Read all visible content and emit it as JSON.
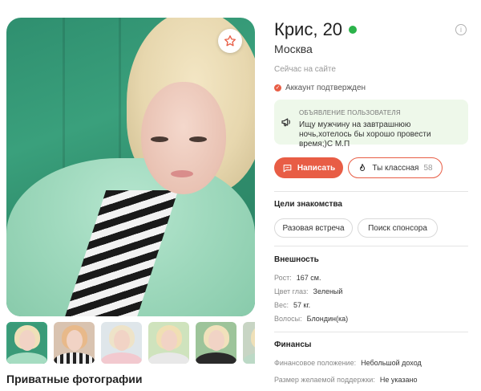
{
  "profile": {
    "name_age": "Крис, 20",
    "city": "Москва",
    "status": "Сейчас на сайте",
    "verified": "Аккаунт подтвержден",
    "online_color": "#2bb34a"
  },
  "announcement": {
    "title": "ОБЪЯВЛЕНИЕ ПОЛЬЗОВАТЕЛЯ",
    "text": "Ищу мужчину на завтрашнюю ночь,хотелось бы хорошо провести время;)С М.П"
  },
  "actions": {
    "write_label": "Написать",
    "like_label": "Ты классная",
    "like_count": "58",
    "accent": "#e85d45"
  },
  "goals": {
    "title": "Цели знакомства",
    "items": [
      "Разовая встреча",
      "Поиск спонсора"
    ]
  },
  "appearance": {
    "title": "Внешность",
    "rows": [
      {
        "label": "Рост:",
        "value": "167 см."
      },
      {
        "label": "Цвет глаз:",
        "value": "Зеленый"
      },
      {
        "label": "Вес:",
        "value": "57 кг."
      },
      {
        "label": "Волосы:",
        "value": "Блондин(ка)"
      }
    ]
  },
  "finance": {
    "title": "Финансы",
    "rows": [
      {
        "label": "Финансовое положение:",
        "value": "Небольшой доход"
      },
      {
        "label": "Размер желаемой поддержки:",
        "value": "Не указано"
      }
    ]
  },
  "gallery": {
    "private_title": "Приватные фотографии",
    "icons": {
      "favorite": "star-icon",
      "write": "chat-icon",
      "like": "flame-icon",
      "announcement": "megaphone-icon",
      "info": "info-icon"
    }
  }
}
